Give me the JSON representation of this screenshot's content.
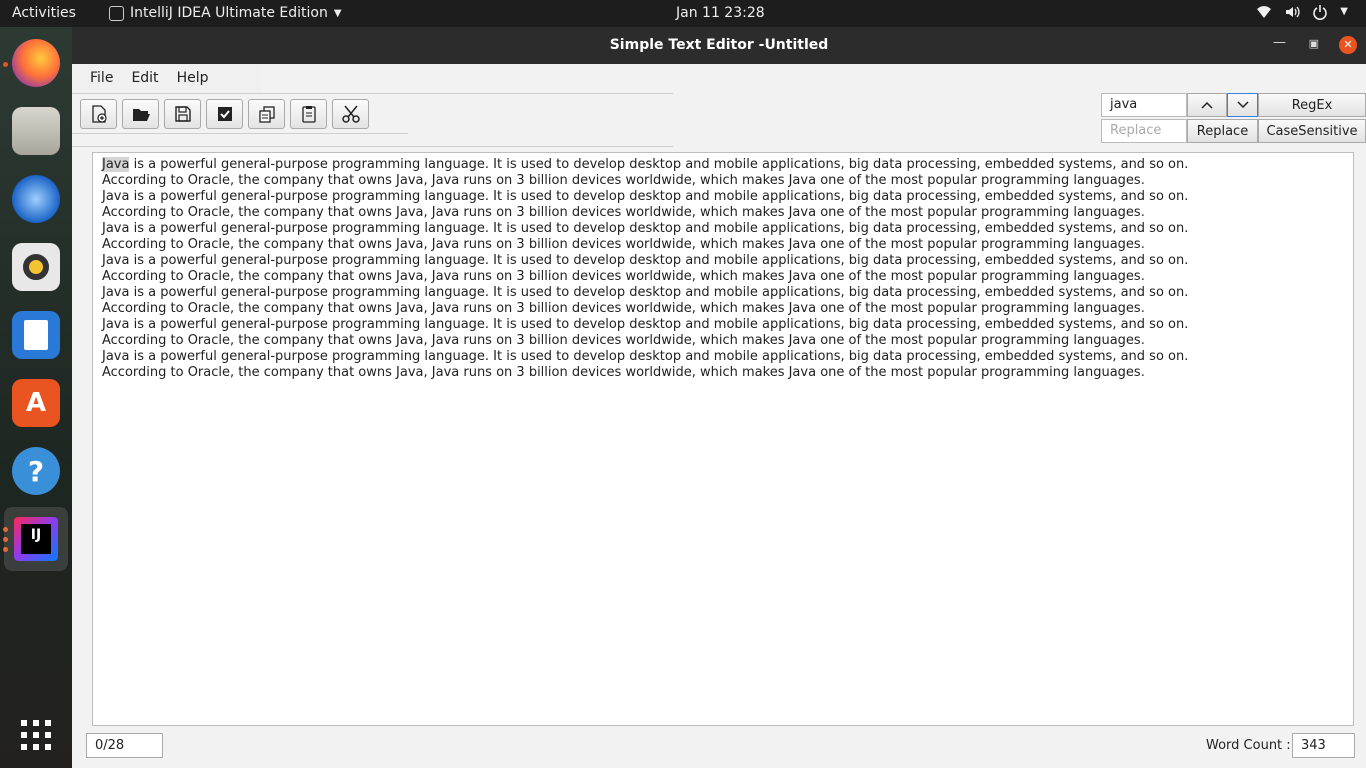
{
  "topbar": {
    "activities": "Activities",
    "app_name": "IntelliJ IDEA Ultimate Edition",
    "clock": "Jan 11  23:28"
  },
  "dock": {
    "items": [
      "firefox-icon",
      "files-icon",
      "thunderbird-icon",
      "rhythmbox-icon",
      "writer-icon",
      "software-icon",
      "help-icon",
      "intellij-icon",
      "show-apps-icon"
    ]
  },
  "window": {
    "title": "Simple Text Editor -Untitled"
  },
  "menu": {
    "file": "File",
    "edit": "Edit",
    "help": "Help"
  },
  "toolbar": {
    "icons": [
      "new-file-icon",
      "open-folder-icon",
      "save-icon",
      "save-as-icon",
      "copy-icon",
      "paste-icon",
      "cut-icon"
    ]
  },
  "search": {
    "find_value": "java",
    "replace_placeholder": "Replace",
    "regex_label": "RegEx",
    "replace_label": "Replace",
    "case_label": "CaseSensitive"
  },
  "editor": {
    "highlight": "Java",
    "line1_rest": " is a powerful general-purpose programming language. It is used to develop desktop and mobile applications, big data processing, embedded systems, and so on.",
    "lines": [
      "According to Oracle, the company that owns Java, Java runs on 3 billion devices worldwide, which makes Java one of the most popular programming languages.",
      "Java is a powerful general-purpose programming language. It is used to develop desktop and mobile applications, big data processing, embedded systems, and so on.",
      "According to Oracle, the company that owns Java, Java runs on 3 billion devices worldwide, which makes Java one of the most popular programming languages.",
      "Java is a powerful general-purpose programming language. It is used to develop desktop and mobile applications, big data processing, embedded systems, and so on.",
      "According to Oracle, the company that owns Java, Java runs on 3 billion devices worldwide, which makes Java one of the most popular programming languages.",
      "Java is a powerful general-purpose programming language. It is used to develop desktop and mobile applications, big data processing, embedded systems, and so on.",
      "According to Oracle, the company that owns Java, Java runs on 3 billion devices worldwide, which makes Java one of the most popular programming languages.",
      "Java is a powerful general-purpose programming language. It is used to develop desktop and mobile applications, big data processing, embedded systems, and so on.",
      "According to Oracle, the company that owns Java, Java runs on 3 billion devices worldwide, which makes Java one of the most popular programming languages.",
      "Java is a powerful general-purpose programming language. It is used to develop desktop and mobile applications, big data processing, embedded systems, and so on.",
      "According to Oracle, the company that owns Java, Java runs on 3 billion devices worldwide, which makes Java one of the most popular programming languages.",
      "Java is a powerful general-purpose programming language. It is used to develop desktop and mobile applications, big data processing, embedded systems, and so on.",
      "According to Oracle, the company that owns Java, Java runs on 3 billion devices worldwide, which makes Java one of the most popular programming languages."
    ]
  },
  "status": {
    "position": "0/28",
    "word_count_label": "Word Count :",
    "word_count": "343"
  },
  "colors": {
    "accent": "#e95420",
    "titlebar": "#2c2c2c",
    "topbar": "#1d1d1d"
  }
}
